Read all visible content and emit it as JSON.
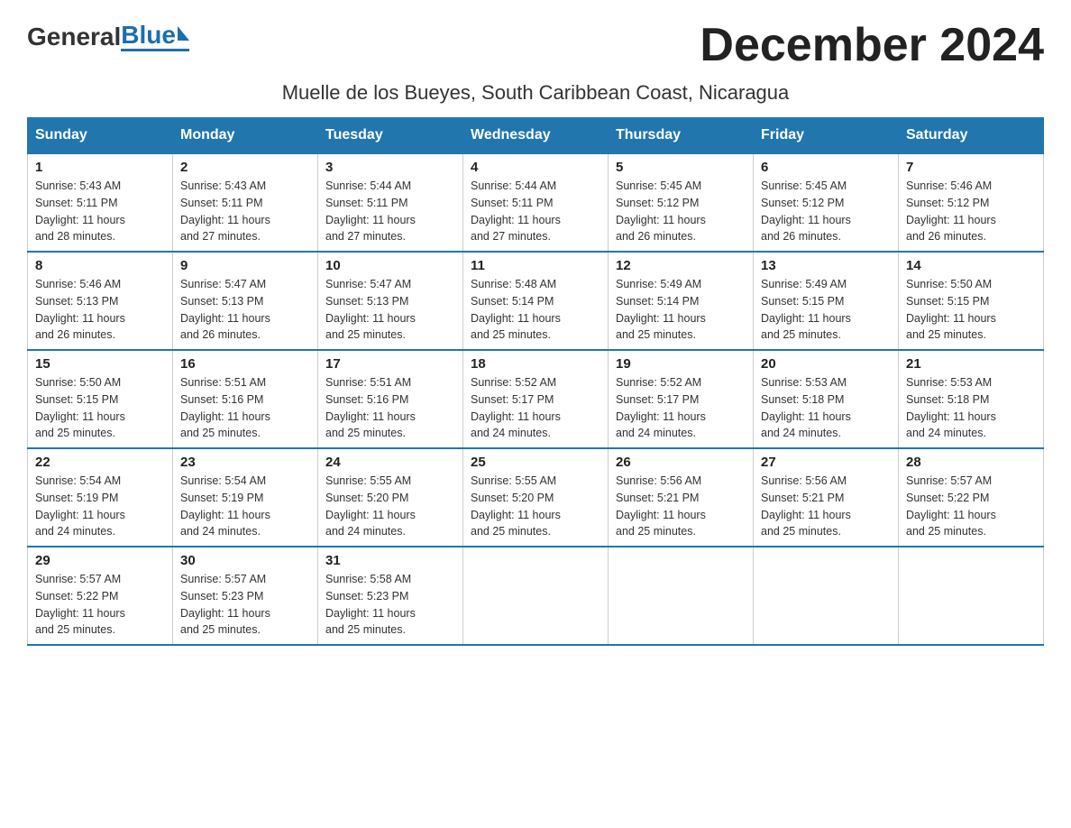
{
  "header": {
    "logo_general": "General",
    "logo_blue": "Blue",
    "month_title": "December 2024",
    "subtitle": "Muelle de los Bueyes, South Caribbean Coast, Nicaragua"
  },
  "calendar": {
    "days_of_week": [
      "Sunday",
      "Monday",
      "Tuesday",
      "Wednesday",
      "Thursday",
      "Friday",
      "Saturday"
    ],
    "weeks": [
      [
        {
          "day": "1",
          "sunrise": "5:43 AM",
          "sunset": "5:11 PM",
          "daylight": "11 hours and 28 minutes."
        },
        {
          "day": "2",
          "sunrise": "5:43 AM",
          "sunset": "5:11 PM",
          "daylight": "11 hours and 27 minutes."
        },
        {
          "day": "3",
          "sunrise": "5:44 AM",
          "sunset": "5:11 PM",
          "daylight": "11 hours and 27 minutes."
        },
        {
          "day": "4",
          "sunrise": "5:44 AM",
          "sunset": "5:11 PM",
          "daylight": "11 hours and 27 minutes."
        },
        {
          "day": "5",
          "sunrise": "5:45 AM",
          "sunset": "5:12 PM",
          "daylight": "11 hours and 26 minutes."
        },
        {
          "day": "6",
          "sunrise": "5:45 AM",
          "sunset": "5:12 PM",
          "daylight": "11 hours and 26 minutes."
        },
        {
          "day": "7",
          "sunrise": "5:46 AM",
          "sunset": "5:12 PM",
          "daylight": "11 hours and 26 minutes."
        }
      ],
      [
        {
          "day": "8",
          "sunrise": "5:46 AM",
          "sunset": "5:13 PM",
          "daylight": "11 hours and 26 minutes."
        },
        {
          "day": "9",
          "sunrise": "5:47 AM",
          "sunset": "5:13 PM",
          "daylight": "11 hours and 26 minutes."
        },
        {
          "day": "10",
          "sunrise": "5:47 AM",
          "sunset": "5:13 PM",
          "daylight": "11 hours and 25 minutes."
        },
        {
          "day": "11",
          "sunrise": "5:48 AM",
          "sunset": "5:14 PM",
          "daylight": "11 hours and 25 minutes."
        },
        {
          "day": "12",
          "sunrise": "5:49 AM",
          "sunset": "5:14 PM",
          "daylight": "11 hours and 25 minutes."
        },
        {
          "day": "13",
          "sunrise": "5:49 AM",
          "sunset": "5:15 PM",
          "daylight": "11 hours and 25 minutes."
        },
        {
          "day": "14",
          "sunrise": "5:50 AM",
          "sunset": "5:15 PM",
          "daylight": "11 hours and 25 minutes."
        }
      ],
      [
        {
          "day": "15",
          "sunrise": "5:50 AM",
          "sunset": "5:15 PM",
          "daylight": "11 hours and 25 minutes."
        },
        {
          "day": "16",
          "sunrise": "5:51 AM",
          "sunset": "5:16 PM",
          "daylight": "11 hours and 25 minutes."
        },
        {
          "day": "17",
          "sunrise": "5:51 AM",
          "sunset": "5:16 PM",
          "daylight": "11 hours and 25 minutes."
        },
        {
          "day": "18",
          "sunrise": "5:52 AM",
          "sunset": "5:17 PM",
          "daylight": "11 hours and 24 minutes."
        },
        {
          "day": "19",
          "sunrise": "5:52 AM",
          "sunset": "5:17 PM",
          "daylight": "11 hours and 24 minutes."
        },
        {
          "day": "20",
          "sunrise": "5:53 AM",
          "sunset": "5:18 PM",
          "daylight": "11 hours and 24 minutes."
        },
        {
          "day": "21",
          "sunrise": "5:53 AM",
          "sunset": "5:18 PM",
          "daylight": "11 hours and 24 minutes."
        }
      ],
      [
        {
          "day": "22",
          "sunrise": "5:54 AM",
          "sunset": "5:19 PM",
          "daylight": "11 hours and 24 minutes."
        },
        {
          "day": "23",
          "sunrise": "5:54 AM",
          "sunset": "5:19 PM",
          "daylight": "11 hours and 24 minutes."
        },
        {
          "day": "24",
          "sunrise": "5:55 AM",
          "sunset": "5:20 PM",
          "daylight": "11 hours and 24 minutes."
        },
        {
          "day": "25",
          "sunrise": "5:55 AM",
          "sunset": "5:20 PM",
          "daylight": "11 hours and 25 minutes."
        },
        {
          "day": "26",
          "sunrise": "5:56 AM",
          "sunset": "5:21 PM",
          "daylight": "11 hours and 25 minutes."
        },
        {
          "day": "27",
          "sunrise": "5:56 AM",
          "sunset": "5:21 PM",
          "daylight": "11 hours and 25 minutes."
        },
        {
          "day": "28",
          "sunrise": "5:57 AM",
          "sunset": "5:22 PM",
          "daylight": "11 hours and 25 minutes."
        }
      ],
      [
        {
          "day": "29",
          "sunrise": "5:57 AM",
          "sunset": "5:22 PM",
          "daylight": "11 hours and 25 minutes."
        },
        {
          "day": "30",
          "sunrise": "5:57 AM",
          "sunset": "5:23 PM",
          "daylight": "11 hours and 25 minutes."
        },
        {
          "day": "31",
          "sunrise": "5:58 AM",
          "sunset": "5:23 PM",
          "daylight": "11 hours and 25 minutes."
        },
        null,
        null,
        null,
        null
      ]
    ],
    "labels": {
      "sunrise": "Sunrise:",
      "sunset": "Sunset:",
      "daylight": "Daylight:"
    }
  }
}
